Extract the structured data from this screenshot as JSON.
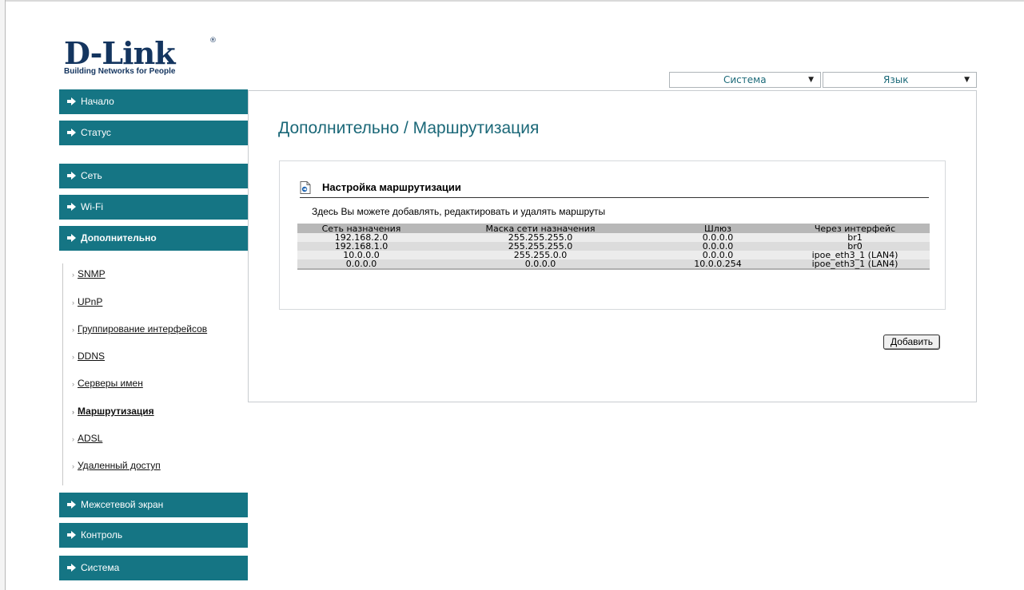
{
  "logo": {
    "brand": "D-Link",
    "reg": "®",
    "tagline": "Building Networks for People"
  },
  "top": {
    "system_select": {
      "value": "Система"
    },
    "language_select": {
      "value": "Язык"
    }
  },
  "sidebar": {
    "items": [
      {
        "label": "Начало"
      },
      {
        "label": "Статус"
      },
      {
        "label": "Сеть"
      },
      {
        "label": "Wi-Fi"
      },
      {
        "label": "Дополнительно"
      },
      {
        "label": "Межсетевой экран"
      },
      {
        "label": "Контроль"
      },
      {
        "label": "Система"
      }
    ],
    "sub_items": [
      {
        "label": "SNMP"
      },
      {
        "label": "UPnP"
      },
      {
        "label": "Группирование интерфейсов"
      },
      {
        "label": "DDNS"
      },
      {
        "label": "Серверы имен"
      },
      {
        "label": "Маршрутизация"
      },
      {
        "label": "ADSL"
      },
      {
        "label": "Удаленный доступ"
      }
    ]
  },
  "main": {
    "title": "Дополнительно /  Маршрутизация",
    "section_title": "Настройка маршрутизации",
    "description": "Здесь Вы можете добавлять, редактировать и удалять маршруты",
    "table": {
      "headers": [
        "Сеть назначения",
        "Маска сети назначения",
        "Шлюз",
        "Через интерфейс"
      ],
      "rows": [
        [
          "192.168.2.0",
          "255.255.255.0",
          "0.0.0.0",
          "br1"
        ],
        [
          "192.168.1.0",
          "255.255.255.0",
          "0.0.0.0",
          "br0"
        ],
        [
          "10.0.0.0",
          "255.255.0.0",
          "0.0.0.0",
          "ipoe_eth3_1 (LAN4)"
        ],
        [
          "0.0.0.0",
          "0.0.0.0",
          "10.0.0.254",
          "ipoe_eth3_1 (LAN4)"
        ]
      ]
    },
    "add_button": "Добавить"
  },
  "colors": {
    "menu": "#157584",
    "title": "#1b6878",
    "brand": "#14355f"
  }
}
